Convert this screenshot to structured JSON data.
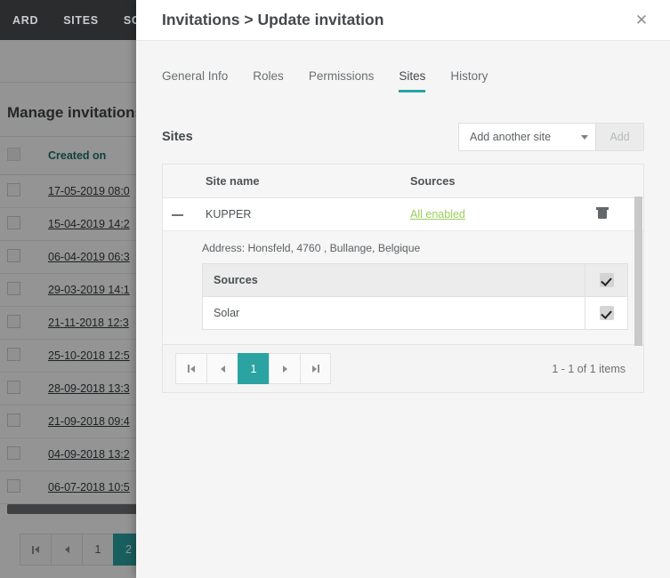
{
  "background": {
    "navbar": {
      "items": [
        {
          "label": "ARD"
        },
        {
          "label": "SITES"
        },
        {
          "label": "SOURCES"
        }
      ]
    },
    "page_title": "Manage invitations",
    "table": {
      "columns": [
        "",
        "Created on"
      ],
      "rows": [
        {
          "created_on": "17-05-2019 08:0"
        },
        {
          "created_on": "15-04-2019 14:2"
        },
        {
          "created_on": "06-04-2019 06:3"
        },
        {
          "created_on": "29-03-2019 14:1"
        },
        {
          "created_on": "21-11-2018 12:3"
        },
        {
          "created_on": "25-10-2018 12:5"
        },
        {
          "created_on": "28-09-2018 13:3"
        },
        {
          "created_on": "21-09-2018 09:4"
        },
        {
          "created_on": "04-09-2018 13:2"
        },
        {
          "created_on": "06-07-2018 10:5"
        }
      ]
    },
    "pager": {
      "first_label": "❘◀",
      "prev_label": "◀",
      "pages": [
        "1",
        "2"
      ],
      "active_page": "2"
    }
  },
  "modal": {
    "title": "Invitations > Update invitation",
    "close_label": "✕",
    "close_icon": "close-icon",
    "tabs": [
      {
        "label": "General Info",
        "active": false
      },
      {
        "label": "Roles",
        "active": false
      },
      {
        "label": "Permissions",
        "active": false
      },
      {
        "label": "Sites",
        "active": true
      },
      {
        "label": "History",
        "active": false
      }
    ],
    "section": {
      "title": "Sites",
      "dropdown_value": "Add another site",
      "dropdown_icon": "chevron-down-icon",
      "add_button_label": "Add"
    },
    "sites_table": {
      "columns": [
        "",
        "Site name",
        "Sources",
        ""
      ],
      "rows": [
        {
          "expand_icon": "minus-icon",
          "site_name": "KUPPER",
          "sources_link": "All enabled",
          "delete_icon": "trash-icon",
          "address": "Address: Honsfeld, 4760 , Bullange, Belgique",
          "sources_table": {
            "columns": [
              "Sources",
              ""
            ],
            "header_checked": true,
            "rows": [
              {
                "name": "Solar",
                "checked": true
              }
            ]
          }
        }
      ]
    },
    "pager": {
      "first_icon": "page-first-icon",
      "prev_icon": "page-prev-icon",
      "next_icon": "page-next-icon",
      "last_icon": "page-last-icon",
      "pages": [
        "1"
      ],
      "active_page": "1",
      "count_label": "1 - 1 of 1 items"
    }
  },
  "colors": {
    "accent_teal": "#2ba3a3",
    "link_green": "#9ace5c",
    "navbar_dark": "#2a2c2e",
    "header_green": "#1d7367"
  }
}
